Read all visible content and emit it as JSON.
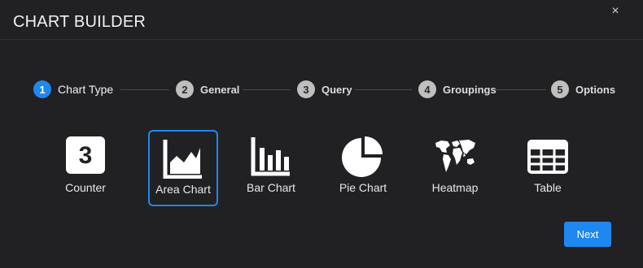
{
  "dialog": {
    "title": "CHART BUILDER",
    "close_icon": "×"
  },
  "wizard": {
    "steps": [
      {
        "number": "1",
        "label": "Chart Type",
        "active": true
      },
      {
        "number": "2",
        "label": "General",
        "active": false
      },
      {
        "number": "3",
        "label": "Query",
        "active": false
      },
      {
        "number": "4",
        "label": "Groupings",
        "active": false
      },
      {
        "number": "5",
        "label": "Options",
        "active": false
      }
    ]
  },
  "chart_types": {
    "selected": "Area Chart",
    "items": [
      {
        "label": "Counter",
        "icon": "counter-icon",
        "glyph": "3"
      },
      {
        "label": "Area Chart",
        "icon": "area-chart-icon"
      },
      {
        "label": "Bar Chart",
        "icon": "bar-chart-icon"
      },
      {
        "label": "Pie Chart",
        "icon": "pie-chart-icon"
      },
      {
        "label": "Heatmap",
        "icon": "world-map-icon"
      },
      {
        "label": "Table",
        "icon": "table-icon"
      }
    ]
  },
  "footer": {
    "next_label": "Next"
  },
  "colors": {
    "background": "#212124",
    "accent": "#1f87f0",
    "step_inactive": "#bfbfbf"
  }
}
